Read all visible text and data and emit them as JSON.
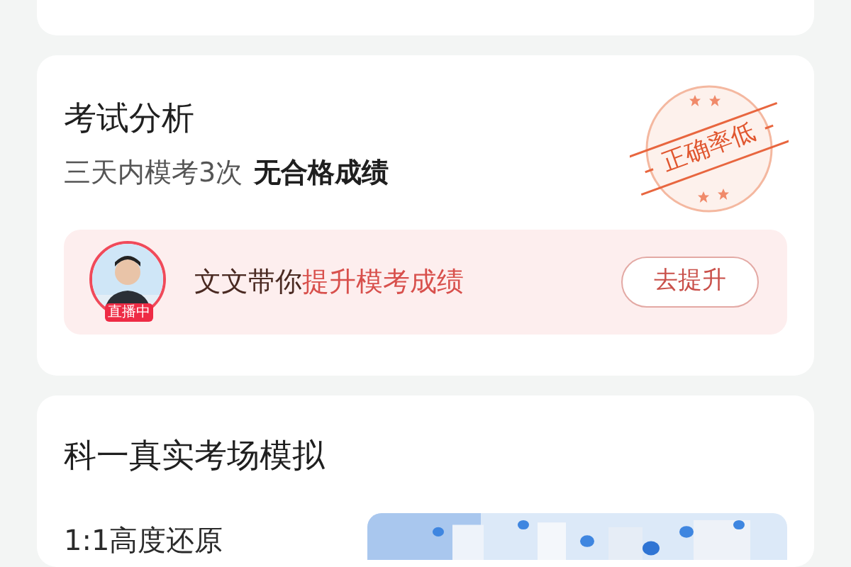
{
  "analysis": {
    "title": "考试分析",
    "summary": "三天内模考3次",
    "result": "无合格成绩",
    "stamp": "正确率低",
    "promo": {
      "avatar": {
        "kind": "picture",
        "badge": "直播中"
      },
      "lead": "文文带你",
      "highlight": "提升模考成绩",
      "button": "去提升"
    }
  },
  "simulation": {
    "title": "科一真实考场模拟",
    "feature": "1:1高度还原"
  }
}
